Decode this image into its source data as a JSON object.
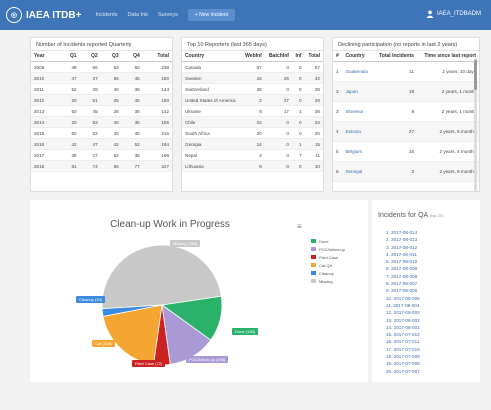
{
  "app": {
    "title": "IAEA ITDB+",
    "user": "IAEA_ITDBADM"
  },
  "nav": {
    "links": [
      "Incidents",
      "Data Ink",
      "Surveys"
    ],
    "new_button": "+ New Incident"
  },
  "panel_quarterly": {
    "title": "Number of Incidents reported Quarterly",
    "headers": [
      "Year",
      "Q1",
      "Q2",
      "Q3",
      "Q4",
      "Total"
    ],
    "rows": [
      [
        "2009",
        "49",
        "66",
        "63",
        "60",
        "238"
      ],
      [
        "2010",
        "47",
        "37",
        "55",
        "45",
        "180"
      ],
      [
        "2011",
        "52",
        "28",
        "40",
        "38",
        "144"
      ],
      [
        "2012",
        "20",
        "51",
        "25",
        "45",
        "150"
      ],
      [
        "2013",
        "50",
        "45",
        "28",
        "38",
        "142"
      ],
      [
        "2014",
        "20",
        "53",
        "40",
        "35",
        "155"
      ],
      [
        "2015",
        "60",
        "52",
        "43",
        "40",
        "215"
      ],
      [
        "2016",
        "42",
        "47",
        "42",
        "52",
        "184"
      ],
      [
        "2017",
        "38",
        "27",
        "62",
        "38",
        "166"
      ],
      [
        "2018",
        "81",
        "74",
        "56",
        "77",
        "327"
      ]
    ]
  },
  "panel_reporters": {
    "title": "Top 10 Reporters (last 365 days)",
    "headers": [
      "Country",
      "WebInf",
      "BatchInf",
      "Inf",
      "Total"
    ],
    "rows": [
      [
        "Canada",
        "57",
        "0",
        "0",
        "57"
      ],
      [
        "Sweden",
        "16",
        "26",
        "0",
        "42"
      ],
      [
        "Switzerland",
        "38",
        "0",
        "0",
        "38"
      ],
      [
        "United States of America",
        "2",
        "27",
        "0",
        "29"
      ],
      [
        "Ukraine",
        "8",
        "17",
        "1",
        "26"
      ],
      [
        "Chile",
        "22",
        "0",
        "0",
        "22"
      ],
      [
        "South Africa",
        "20",
        "0",
        "0",
        "20"
      ],
      [
        "Georgia",
        "14",
        "0",
        "1",
        "15"
      ],
      [
        "Nepal",
        "4",
        "0",
        "7",
        "11"
      ],
      [
        "Lithuania",
        "8",
        "0",
        "0",
        "10"
      ]
    ]
  },
  "panel_declining": {
    "title": "Declining participation (no reports in last 2 years)",
    "headers": [
      "#",
      "Country",
      "Total Incidents",
      "Time since last report"
    ],
    "rows": [
      [
        "1",
        "Guatemala",
        "11",
        "2 years, 10 days"
      ],
      [
        "2",
        "Japan",
        "19",
        "2 years, 1 month"
      ],
      [
        "3",
        "Slovenia",
        "8",
        "2 years, 1 month"
      ],
      [
        "4",
        "Estonia",
        "27",
        "2 years, 5 months"
      ],
      [
        "5",
        "Belgium",
        "15",
        "2 years, 4 months"
      ],
      [
        "6",
        "Senegal",
        "3",
        "2 years, 6 months"
      ]
    ]
  },
  "chart_data": {
    "type": "pie",
    "title": "Clean-up Work in Progress",
    "slices": [
      {
        "label": "Missing (786)",
        "value": 786,
        "color": "#c8c8c8"
      },
      {
        "label": "Done (198)",
        "value": 198,
        "color": "#2ab26a"
      },
      {
        "label": "POC/follow-up (208)",
        "value": 208,
        "color": "#a99ad6"
      },
      {
        "label": "Field Case (72)",
        "value": 72,
        "color": "#cc2222"
      },
      {
        "label": "Cat (318)",
        "value": 318,
        "color": "#f5a632"
      },
      {
        "label": "Cleanup (33)",
        "value": 33,
        "color": "#3a8be0"
      }
    ],
    "legend": [
      "Done",
      "POC/follow-up",
      "Field Case",
      "Cat QA",
      "Cleanup",
      "Missing"
    ],
    "legend_colors": [
      "#2ab26a",
      "#a99ad6",
      "#cc2222",
      "#f5a632",
      "#3a8be0",
      "#c8c8c8"
    ]
  },
  "qa": {
    "title": "Incidents for QA",
    "subtitle": "(top 20)",
    "items": [
      "1. 2017-08-014",
      "2. 2017-08-013",
      "3. 2017-08-012",
      "4. 2017-08-011",
      "5. 2017-08-010",
      "6. 2017-08-009",
      "7. 2017-08-008",
      "8. 2017-08-007",
      "9. 2017-08-006",
      "10. 2017-08-005",
      "11. 2017-08-004",
      "12. 2017-08-003",
      "13. 2017-08-002",
      "14. 2017-08-001",
      "15. 2017-07-012",
      "16. 2017-07-011",
      "17. 2017-07-010",
      "18. 2017-07-009",
      "19. 2017-07-008",
      "20. 2017-07-007"
    ]
  }
}
